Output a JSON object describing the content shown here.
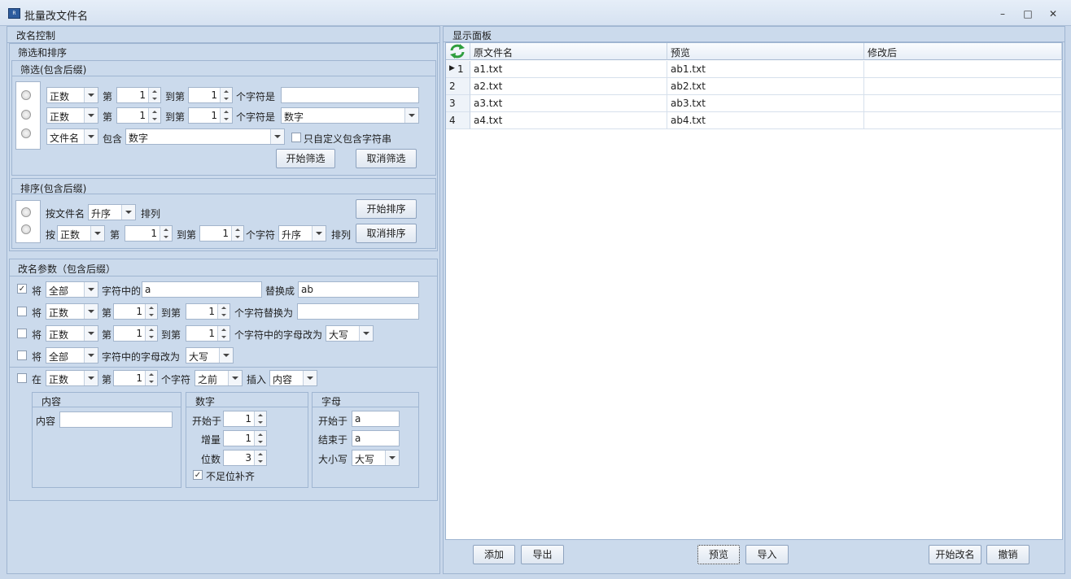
{
  "window": {
    "title": "批量改文件名",
    "icon": "app-logo-icon"
  },
  "left_panel": {
    "title": "改名控制",
    "filter_sort_title": "筛选和排序",
    "filter": {
      "title": "筛选(包含后缀)",
      "row1": {
        "type": "正数",
        "di": "第",
        "from": "1",
        "to_label": "到第",
        "to": "1",
        "suffix": "个字符是",
        "value": ""
      },
      "row2": {
        "type": "正数",
        "di": "第",
        "from": "1",
        "to_label": "到第",
        "to": "1",
        "suffix": "个字符是",
        "value": "数字"
      },
      "row3": {
        "type": "文件名",
        "contains": "包含",
        "value": "数字",
        "custom_label": "只自定义包含字符串"
      },
      "start_btn": "开始筛选",
      "cancel_btn": "取消筛选"
    },
    "sort": {
      "title": "排序(包含后缀)",
      "row1": {
        "prefix": "按文件名",
        "order": "升序",
        "suffix": "排列"
      },
      "row2": {
        "prefix": "按",
        "type": "正数",
        "di": "第",
        "from": "1",
        "to_label": "到第",
        "to": "1",
        "mid": "个字符",
        "order": "升序",
        "suffix": "排列"
      },
      "start_btn": "开始排序",
      "cancel_btn": "取消排序"
    },
    "rename": {
      "title": "改名参数（包含后缀）",
      "row1": {
        "checked": true,
        "jiang": "将",
        "type": "全部",
        "label": "字符中的",
        "find": "a",
        "replace_label": "替换成",
        "replace": "ab"
      },
      "row2": {
        "checked": false,
        "jiang": "将",
        "type": "正数",
        "di": "第",
        "from": "1",
        "to_label": "到第",
        "to": "1",
        "label": "个字符替换为",
        "value": ""
      },
      "row3": {
        "checked": false,
        "jiang": "将",
        "type": "正数",
        "di": "第",
        "from": "1",
        "to_label": "到第",
        "to": "1",
        "label": "个字符中的字母改为",
        "case": "大写"
      },
      "row4": {
        "checked": false,
        "jiang": "将",
        "type": "全部",
        "label": "字符中的字母改为",
        "case": "大写"
      },
      "insert": {
        "checked": false,
        "zai": "在",
        "type": "正数",
        "di": "第",
        "pos": "1",
        "label": "个字符",
        "where": "之前",
        "insert_label": "插入",
        "what": "内容"
      },
      "content": {
        "title": "内容",
        "label": "内容",
        "value": ""
      },
      "number": {
        "title": "数字",
        "start_label": "开始于",
        "start": "1",
        "step_label": "增量",
        "step": "1",
        "digits_label": "位数",
        "digits": "3",
        "pad_label": "不足位补齐",
        "pad_checked": true
      },
      "letter": {
        "title": "字母",
        "start_label": "开始于",
        "start": "a",
        "end_label": "结束于",
        "end": "a",
        "case_label": "大小写",
        "case": "大写"
      }
    }
  },
  "right_panel": {
    "title": "显示面板",
    "refresh_icon": "refresh-icon",
    "columns": [
      "原文件名",
      "预览",
      "修改后"
    ],
    "rows": [
      {
        "num": "1",
        "orig": "a1.txt",
        "preview": "ab1.txt",
        "after": ""
      },
      {
        "num": "2",
        "orig": "a2.txt",
        "preview": "ab2.txt",
        "after": ""
      },
      {
        "num": "3",
        "orig": "a3.txt",
        "preview": "ab3.txt",
        "after": ""
      },
      {
        "num": "4",
        "orig": "a4.txt",
        "preview": "ab4.txt",
        "after": ""
      }
    ],
    "buttons": {
      "add": "添加",
      "export": "导出",
      "preview": "预览",
      "import": "导入",
      "rename": "开始改名",
      "undo": "撤销"
    }
  }
}
